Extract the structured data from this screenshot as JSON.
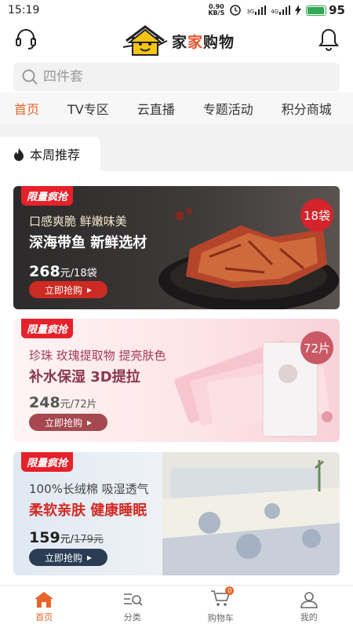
{
  "status_bar": {
    "time": "15:19",
    "net_speed_value": "0.90",
    "net_speed_unit": "KB/S",
    "signal1": "3G",
    "signal2": "4G",
    "battery": "95"
  },
  "header": {
    "logo_text_1": "家",
    "logo_text_2": "家",
    "logo_text_3": "购物"
  },
  "search": {
    "placeholder": "四件套"
  },
  "tabs": [
    {
      "label": "首页",
      "active": true
    },
    {
      "label": "TV专区"
    },
    {
      "label": "云直播"
    },
    {
      "label": "专题活动"
    },
    {
      "label": "积分商城"
    }
  ],
  "section": {
    "title": "本周推荐"
  },
  "banners": [
    {
      "tag": "限量疯抢",
      "line1": "口感爽脆 鲜嫩味美",
      "line2": "深海带鱼 新鲜选材",
      "price": "268",
      "price_unit": "元/18袋",
      "button": "立即抢购",
      "badge": "18袋"
    },
    {
      "tag": "限量疯抢",
      "line1": "珍珠 玫瑰提取物 提亮肤色",
      "line2": "补水保湿 3D提拉",
      "price": "248",
      "price_unit": "元/72片",
      "button": "立即抢购",
      "badge": "72片"
    },
    {
      "tag": "限量疯抢",
      "line1": "100%长绒棉 吸湿透气",
      "line2": "柔软亲肤 健康睡眠",
      "price": "159",
      "price_unit": "元/",
      "old_price": "179元",
      "button": "立即抢购"
    }
  ],
  "bottom_nav": [
    {
      "label": "首页",
      "active": true
    },
    {
      "label": "分类"
    },
    {
      "label": "购物车",
      "badge": "0"
    },
    {
      "label": "我的"
    }
  ]
}
